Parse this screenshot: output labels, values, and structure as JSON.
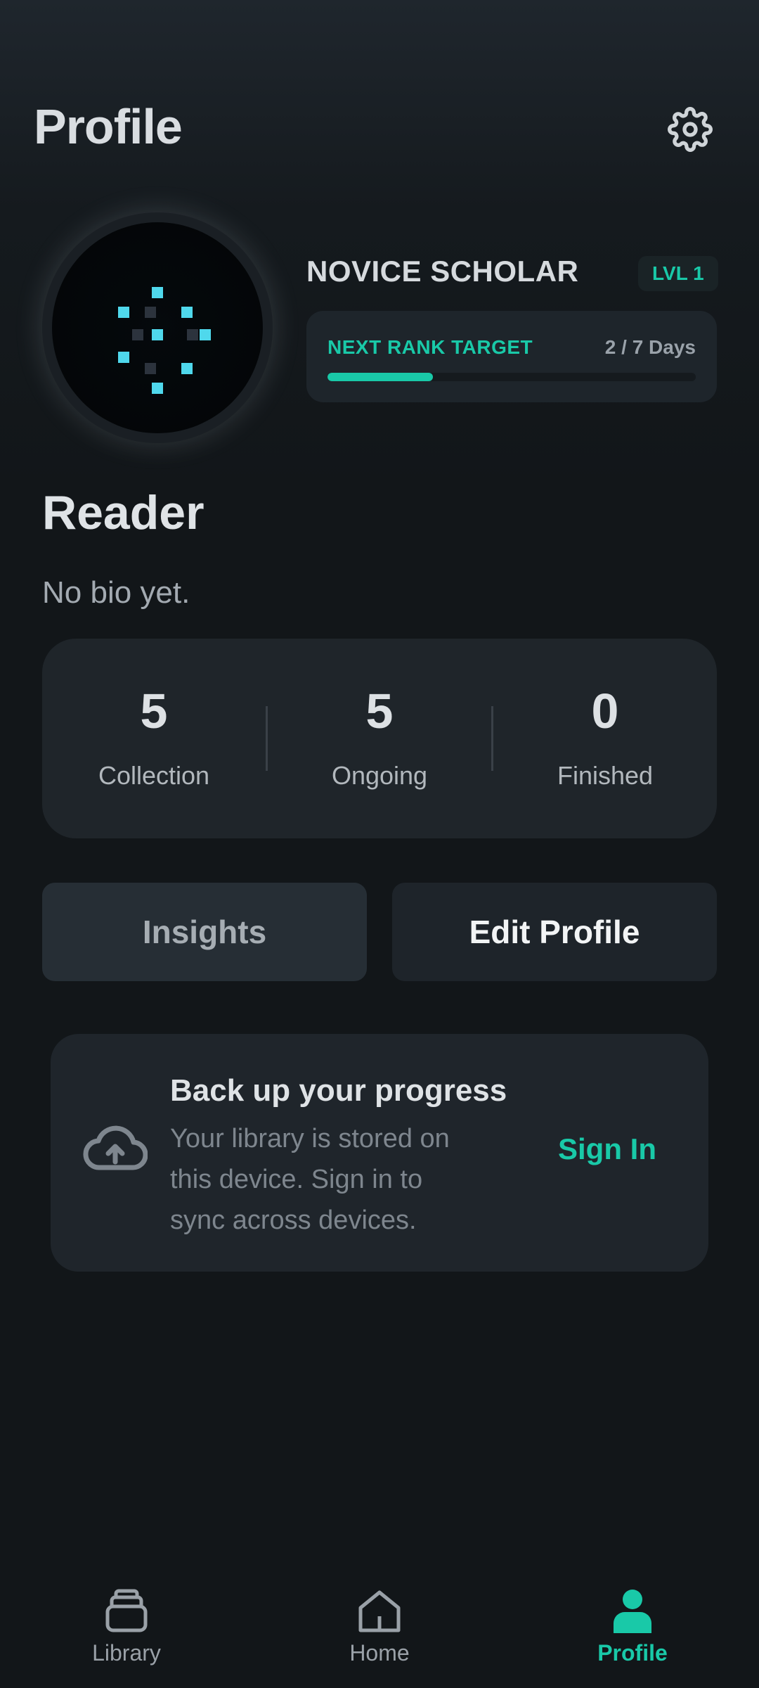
{
  "header": {
    "title": "Profile",
    "settings_icon": "gear-icon"
  },
  "rank": {
    "title": "NOVICE SCHOLAR",
    "level": "LVL 1",
    "target_label": "NEXT RANK TARGET",
    "days": "2 / 7 Days",
    "progress_fraction": 0.2857
  },
  "profile": {
    "name": "Reader",
    "bio": "No bio yet."
  },
  "stats": [
    {
      "value": "5",
      "label": "Collection"
    },
    {
      "value": "5",
      "label": "Ongoing"
    },
    {
      "value": "0",
      "label": "Finished"
    }
  ],
  "actions": {
    "insights": "Insights",
    "edit": "Edit Profile"
  },
  "backup": {
    "icon": "cloud-upload-icon",
    "title": "Back up your progress",
    "text": "Your library is stored on this device. Sign in to sync across devices.",
    "signin": "Sign In"
  },
  "nav": [
    {
      "label": "Library",
      "icon": "library-icon",
      "active": false
    },
    {
      "label": "Home",
      "icon": "home-icon",
      "active": false
    },
    {
      "label": "Profile",
      "icon": "person-icon",
      "active": true
    }
  ],
  "colors": {
    "accent": "#19c9a8",
    "avatar_pixel": "#4fd8ec",
    "background": "#121619"
  }
}
